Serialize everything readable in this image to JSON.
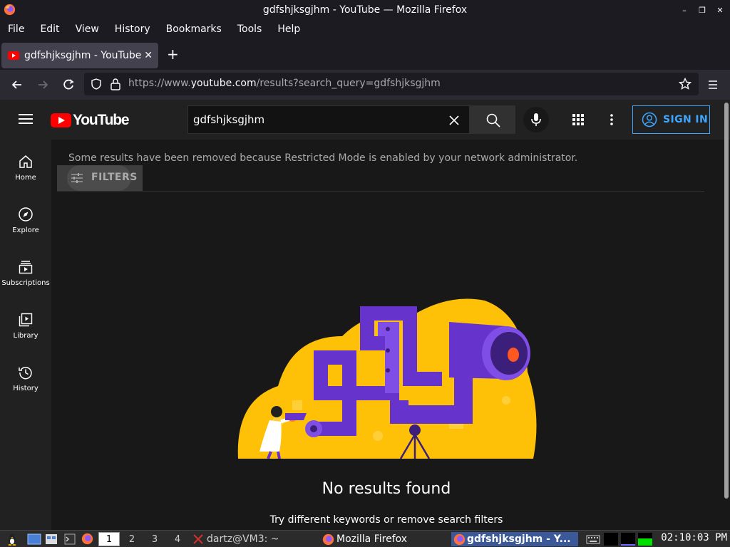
{
  "window": {
    "title": "gdfshjksgjhm - YouTube — Mozilla Firefox"
  },
  "menu": {
    "items": [
      "File",
      "Edit",
      "View",
      "History",
      "Bookmarks",
      "Tools",
      "Help"
    ]
  },
  "tab": {
    "title": "gdfshjksgjhm - YouTube"
  },
  "address": {
    "url_prefix": "https://www.",
    "url_domain": "youtube.com",
    "url_path": "/results?search_query=gdfshjksgjhm"
  },
  "youtube": {
    "logo_text": "YouTube",
    "search_query": "gdfshjksgjhm",
    "signin_label": "SIGN IN",
    "guide": [
      {
        "label": "Home",
        "icon": "home-icon"
      },
      {
        "label": "Explore",
        "icon": "compass-icon"
      },
      {
        "label": "Subscriptions",
        "icon": "subscriptions-icon"
      },
      {
        "label": "Library",
        "icon": "library-icon"
      },
      {
        "label": "History",
        "icon": "history-icon"
      }
    ],
    "restricted_notice": "Some results have been removed because Restricted Mode is enabled by your network administrator.",
    "filters_label": "FILTERS",
    "no_results_title": "No results found",
    "no_results_hint": "Try different keywords or remove search filters"
  },
  "taskbar": {
    "workspaces": [
      "1",
      "2",
      "3",
      "4"
    ],
    "active_workspace": "1",
    "tasks": [
      {
        "label": "dartz@VM3: ~",
        "icon": "terminal-icon"
      },
      {
        "label": "Mozilla Firefox",
        "icon": "firefox-icon"
      },
      {
        "label": "gdfshjksgjhm - Y...",
        "icon": "firefox-icon"
      }
    ],
    "clock": "02:10:03 PM"
  },
  "colors": {
    "youtube_red": "#ff0000",
    "signin_blue": "#3ea6ff",
    "illustration_yellow": "#ffc107",
    "illustration_purple": "#6633cc"
  }
}
